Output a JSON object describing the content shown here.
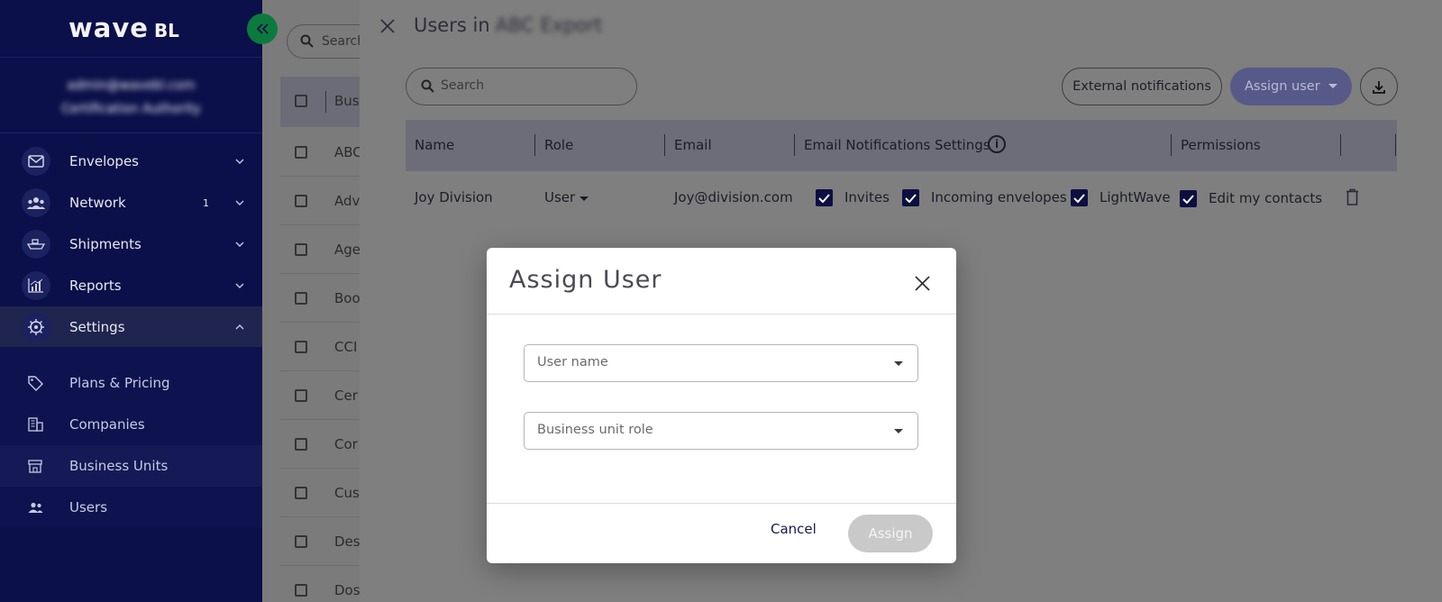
{
  "sidebar": {
    "logo": "wave",
    "logo_suffix": "BL",
    "user_email": "admin@wavebl.com",
    "user_org": "Certification Authority",
    "nav": [
      {
        "label": "Envelopes",
        "icon": "envelope-icon",
        "expanded": false
      },
      {
        "label": "Network",
        "icon": "network-icon",
        "badge": "1",
        "expanded": false
      },
      {
        "label": "Shipments",
        "icon": "ship-icon",
        "expanded": false
      },
      {
        "label": "Reports",
        "icon": "chart-icon",
        "expanded": false
      },
      {
        "label": "Settings",
        "icon": "gear-icon",
        "expanded": true
      }
    ],
    "settings_sub": [
      {
        "label": "Plans & Pricing",
        "icon": "tag-icon"
      },
      {
        "label": "Companies",
        "icon": "building-icon"
      },
      {
        "label": "Business Units",
        "icon": "store-icon",
        "active": true
      },
      {
        "label": "Users",
        "icon": "users-icon"
      }
    ]
  },
  "background_list": {
    "search_placeholder": "Search",
    "header": "Bus",
    "rows": [
      "ABC",
      "Adv",
      "Age",
      "Boo",
      "CCI",
      "Cer",
      "Cor",
      "Cus",
      "Des",
      "Dos"
    ]
  },
  "drawer": {
    "title_prefix": "Users in",
    "title_unit": "ABC Export",
    "search_placeholder": "Search",
    "btn_external": "External notifications",
    "btn_assign": "Assign user",
    "table": {
      "columns": [
        "Name",
        "Role",
        "Email",
        "Email Notifications Settings",
        "Permissions"
      ],
      "rows": [
        {
          "name": "Joy Division",
          "role": "User",
          "email": "Joy@division.com",
          "notifications": [
            "Invites",
            "Incoming envelopes",
            "LightWave"
          ],
          "permissions": [
            "Edit my contacts"
          ]
        }
      ]
    }
  },
  "modal": {
    "title": "Assign User",
    "user_name_placeholder": "User name",
    "role_placeholder": "Business unit role",
    "cancel": "Cancel",
    "assign": "Assign"
  },
  "colors": {
    "sidebar_bg": "#0b0f4a",
    "accent_green": "#0c7a3e",
    "checkbox": "#0c0f3f",
    "assign_btn": "#575a88",
    "modal_assign_disabled": "#c9c9c9"
  }
}
